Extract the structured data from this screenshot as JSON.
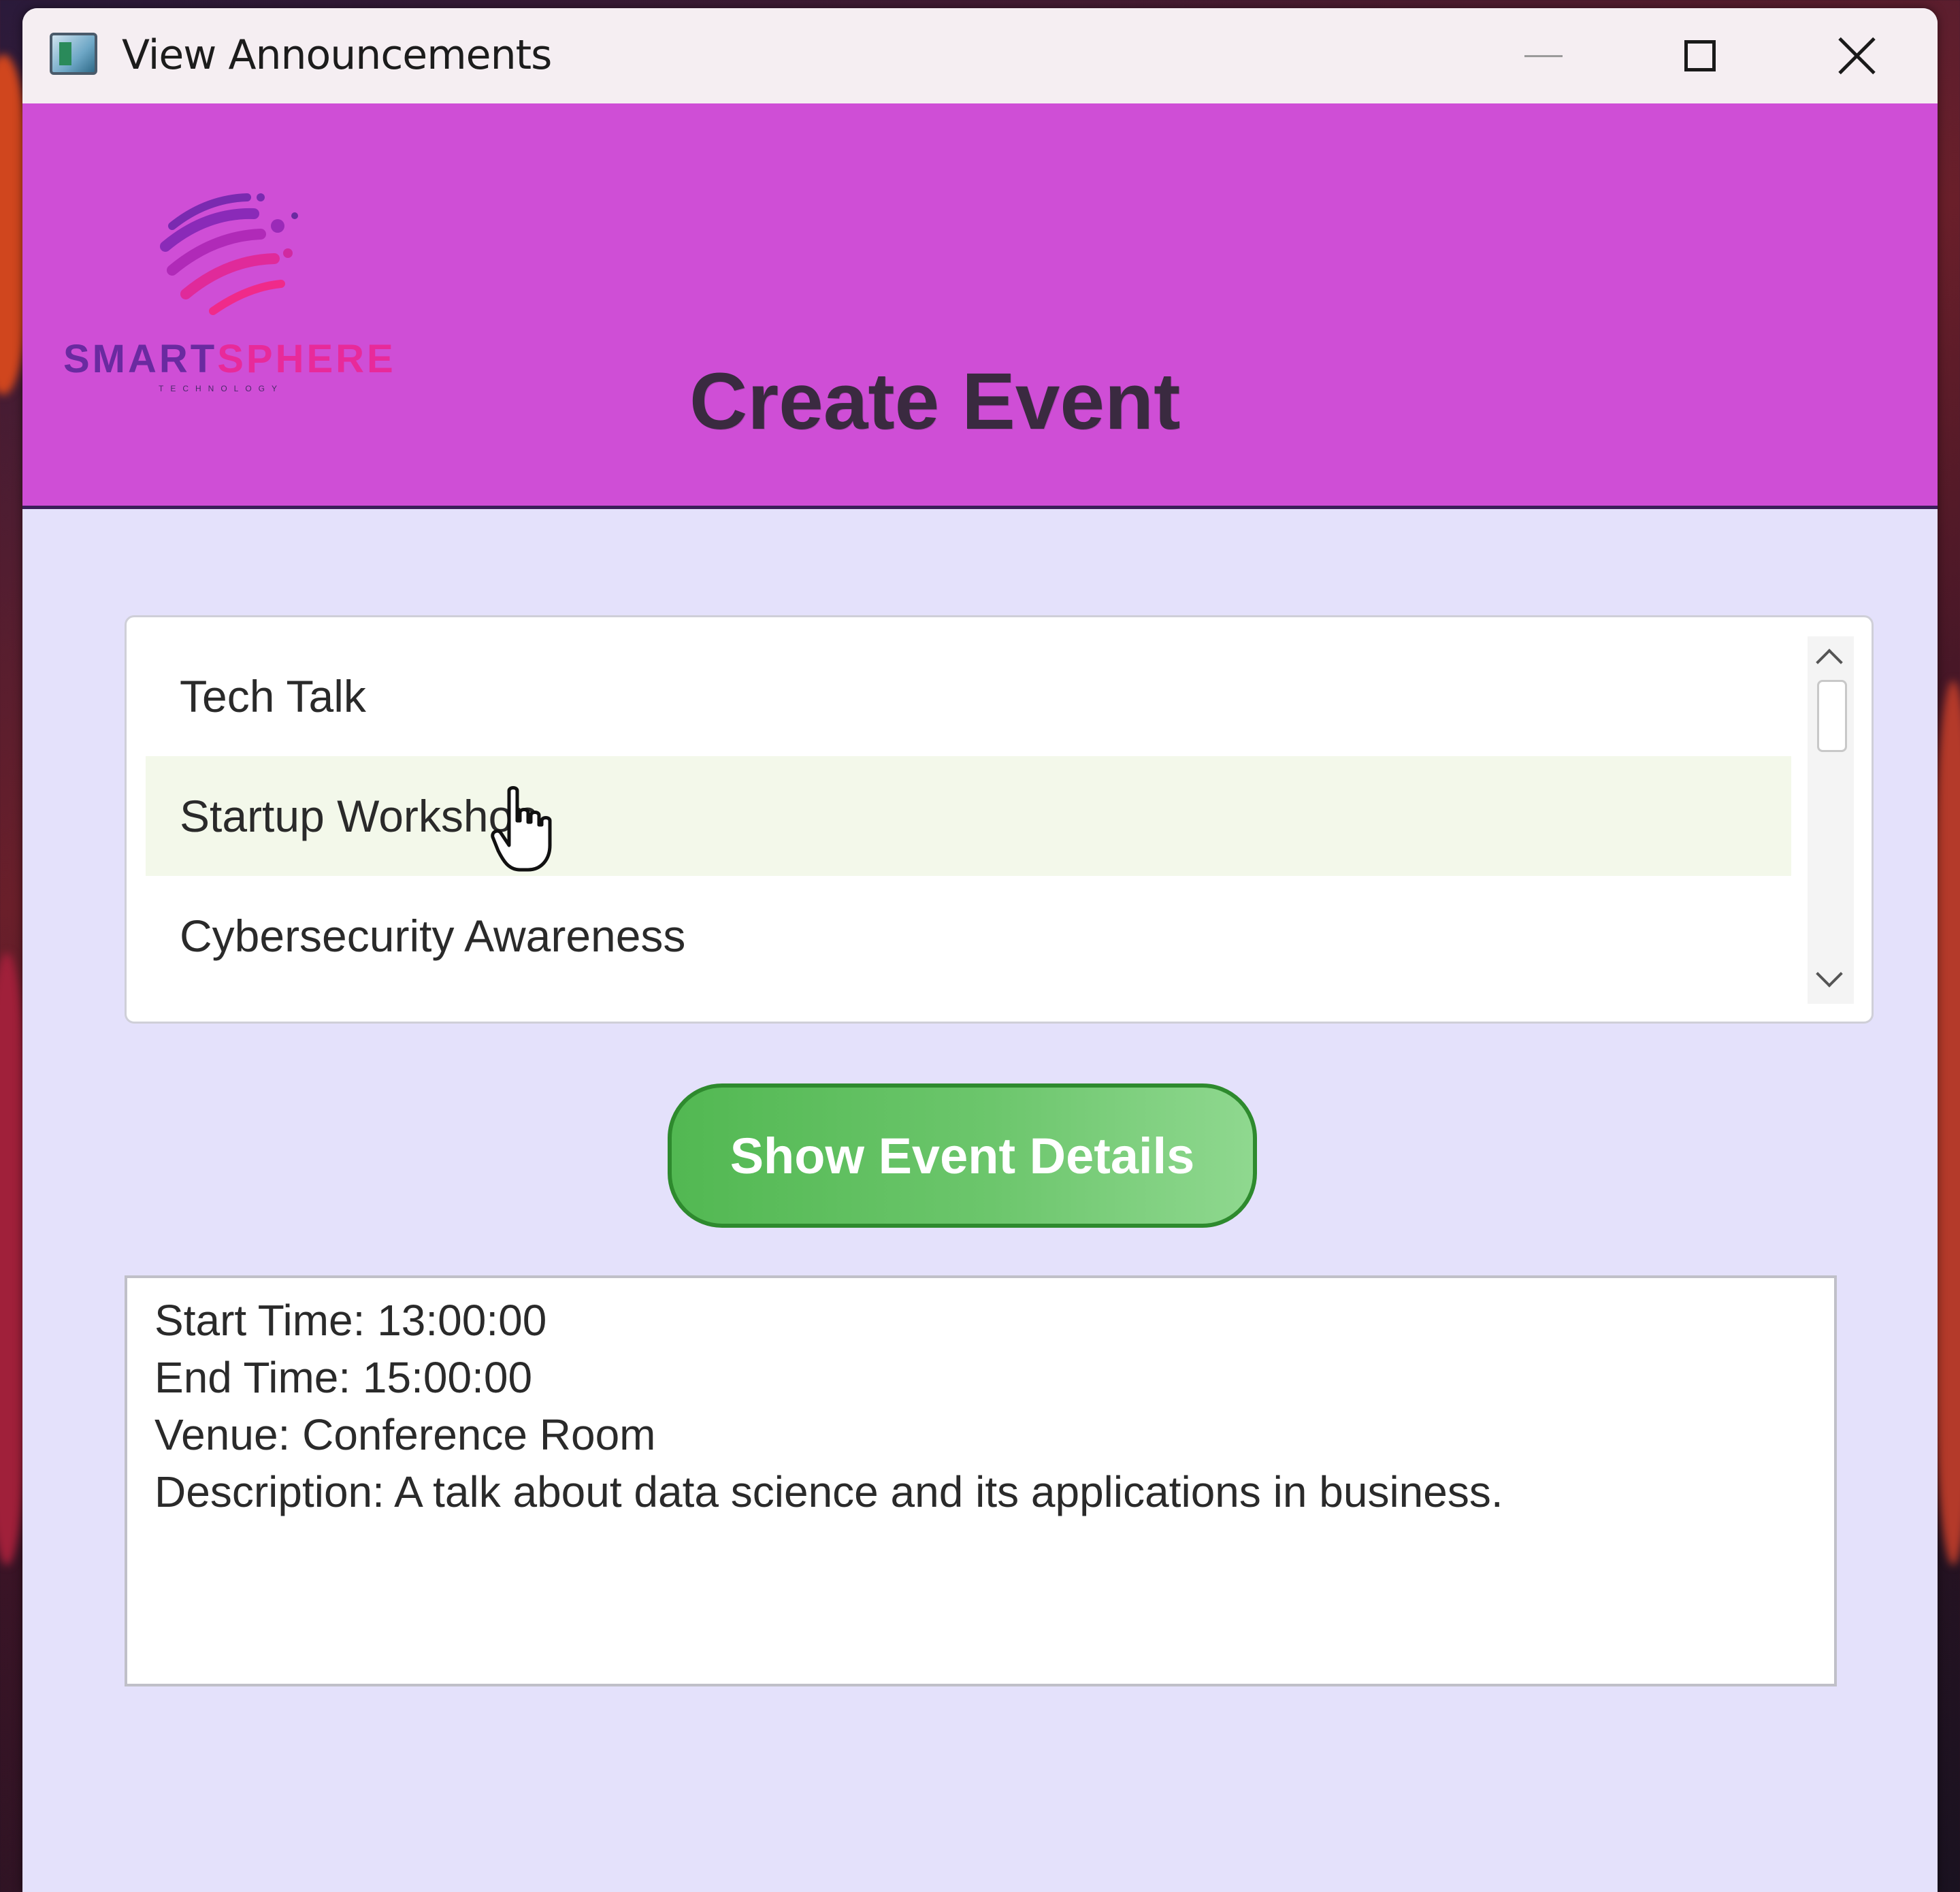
{
  "window": {
    "title": "View Announcements"
  },
  "header": {
    "title": "Create Event",
    "logo": {
      "name_part1": "SMART",
      "name_part2": "SPHERE",
      "tagline": "TECHNOLOGY"
    },
    "background_color": "#cf4ed6"
  },
  "event_list": {
    "items": [
      {
        "label": "Tech Talk",
        "hovered": false
      },
      {
        "label": "Startup Workshop",
        "hovered": true
      },
      {
        "label": "Cybersecurity Awareness",
        "hovered": false
      }
    ]
  },
  "actions": {
    "show_details_label": "Show Event Details",
    "button_color": "#5cbf5c"
  },
  "details": {
    "start_time": "Start Time: 13:00:00",
    "end_time": "End Time: 15:00:00",
    "venue": "Venue: Conference Room",
    "description": "Description: A talk about data science and its applications in business."
  },
  "icons": {
    "app": "app-window-icon",
    "minimize": "minimize-icon",
    "maximize": "maximize-icon",
    "close": "close-icon",
    "cursor": "hand-pointer-icon"
  }
}
